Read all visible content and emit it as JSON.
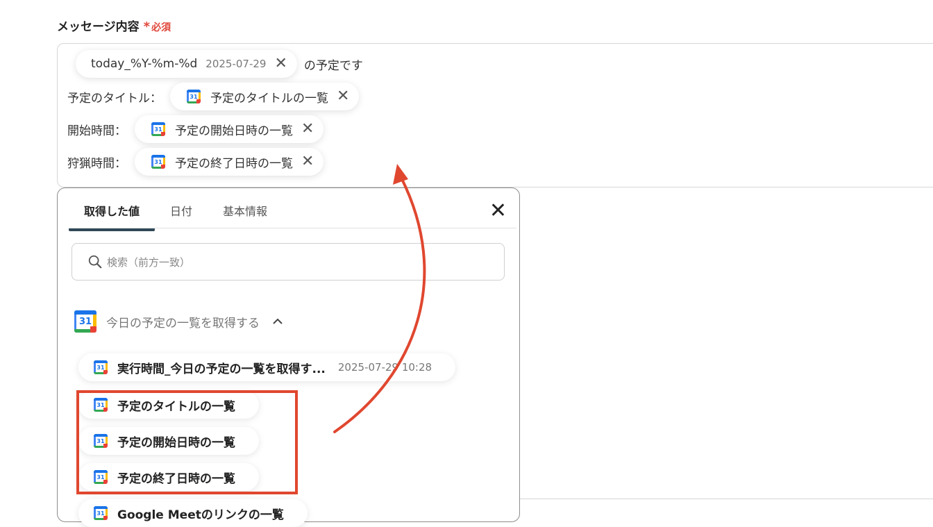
{
  "field": {
    "label": "メッセージ内容",
    "required_star": "*",
    "required_text": "必須"
  },
  "editor": {
    "line1": {
      "pill_label": "today_%Y-%m-%d",
      "pill_value": "2025-07-29",
      "after_text": "の予定です"
    },
    "line2": {
      "label": "予定のタイトル：",
      "pill_label": "予定のタイトルの一覧"
    },
    "line3": {
      "label": "開始時間：",
      "pill_label": "予定の開始日時の一覧"
    },
    "line4": {
      "label": "狩猟時間：",
      "pill_label": "予定の終了日時の一覧"
    },
    "remove_glyph": "✕"
  },
  "panel": {
    "tabs": [
      {
        "label": "取得した値",
        "active": true
      },
      {
        "label": "日付",
        "active": false
      },
      {
        "label": "基本情報",
        "active": false
      }
    ],
    "close_glyph": "✕",
    "search": {
      "placeholder": "検索（前方一致）"
    },
    "group": {
      "title": "今日の予定の一覧を取得する",
      "chevron": "^",
      "calendar_day": "31"
    },
    "items": [
      {
        "label": "実行時間_今日の予定の一覧を取得す...",
        "time": "2025-07-29 10:28"
      },
      {
        "label": "予定のタイトルの一覧"
      },
      {
        "label": "予定の開始日時の一覧"
      },
      {
        "label": "予定の終了日時の一覧"
      },
      {
        "label": "Google Meetのリンクの一覧"
      }
    ]
  },
  "colors": {
    "accent_red": "#e0472f",
    "tab_underline": "#2f4857",
    "calendar_blue": "#4285f4"
  },
  "icons": [
    "calendar-icon",
    "close-icon",
    "search-icon",
    "chevron-up-icon"
  ]
}
